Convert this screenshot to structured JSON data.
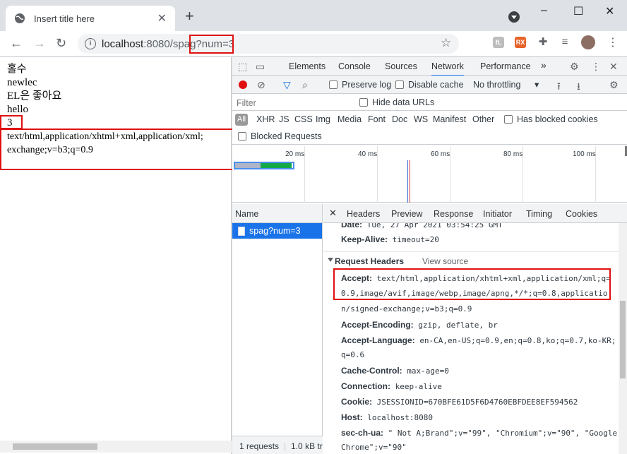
{
  "browser": {
    "tab_title": "Insert title here",
    "tab_close": "✕",
    "new_tab": "+",
    "window_controls": [
      "–",
      "☐",
      "✕"
    ],
    "url_host": "localhost",
    "url_rest": ":8080/spag?num=3",
    "extensions": [
      {
        "name": "instapaper-icon",
        "label": "I",
        "color": "#616161"
      },
      {
        "name": "fnote-icon",
        "label": "fL",
        "color": "#9e9e9e"
      },
      {
        "name": "rss-icon",
        "label": "RX",
        "color": "#e8632a"
      }
    ]
  },
  "page": {
    "lines": [
      "홀수",
      "newlec",
      "EL은 좋아요",
      "hello",
      "3"
    ],
    "accept_line1": "text/html,application/xhtml+xml,application/xml;",
    "accept_line2": "exchange;v=b3;q=0.9"
  },
  "devtools": {
    "tabs": [
      "Elements",
      "Console",
      "Sources",
      "Network",
      "Performance"
    ],
    "active_tab": "Network",
    "more_tabs": "»",
    "preserve_log": "Preserve log",
    "disable_cache": "Disable cache",
    "throttling": "No throttling",
    "filter_placeholder": "Filter",
    "hide_data_urls": "Hide data URLs",
    "filter_all": "All",
    "filter_types": [
      "XHR",
      "JS",
      "CSS",
      "Img",
      "Media",
      "Font",
      "Doc",
      "WS",
      "Manifest",
      "Other"
    ],
    "has_blocked_cookies": "Has blocked cookies",
    "blocked_requests": "Blocked Requests",
    "timeline_ticks": [
      "20 ms",
      "40 ms",
      "60 ms",
      "80 ms",
      "100 ms"
    ],
    "name_header": "Name",
    "request_name": "spag?num=3",
    "footer_requests": "1 requests",
    "footer_transferred": "1.0 kB tr",
    "detail_tabs": [
      "Headers",
      "Preview",
      "Response",
      "Initiator",
      "Timing",
      "Cookies"
    ],
    "response_headers_tail": [
      {
        "key": "Date:",
        "value": "Tue, 27 Apr 2021 03:54:25 GMT"
      },
      {
        "key": "Keep-Alive:",
        "value": "timeout=20"
      }
    ],
    "request_headers_title": "Request Headers",
    "view_source": "View source",
    "accept_key": "Accept:",
    "accept_value_1": "text/html,application/xhtml+xml,application/xml;q=",
    "accept_value_2": "0.9,image/avif,image/webp,image/apng,*/*;q=0.8,applicatio",
    "accept_value_3": "n/signed-exchange;v=b3;q=0.9",
    "accept_encoding_key": "Accept-Encoding:",
    "accept_encoding_value": "gzip, deflate, br",
    "accept_language_key": "Accept-Language:",
    "accept_language_value": "en-CA,en-US;q=0.9,en;q=0.8,ko;q=0.7,ko-KR;",
    "accept_language_value_2": "q=0.6",
    "cache_control_key": "Cache-Control:",
    "cache_control_value": "max-age=0",
    "connection_key": "Connection:",
    "connection_value": "keep-alive",
    "cookie_key": "Cookie:",
    "cookie_value": "JSESSIONID=670BFE61D5F6D4760EBFDEE8EF594562",
    "host_key": "Host:",
    "host_value": "localhost:8080",
    "sec_ch_ua_key": "sec-ch-ua:",
    "sec_ch_ua_value": "\" Not A;Brand\";v=\"99\", \"Chromium\";v=\"90\", \"Google",
    "sec_ch_ua_value_2": "Chrome\";v=\"90\""
  }
}
